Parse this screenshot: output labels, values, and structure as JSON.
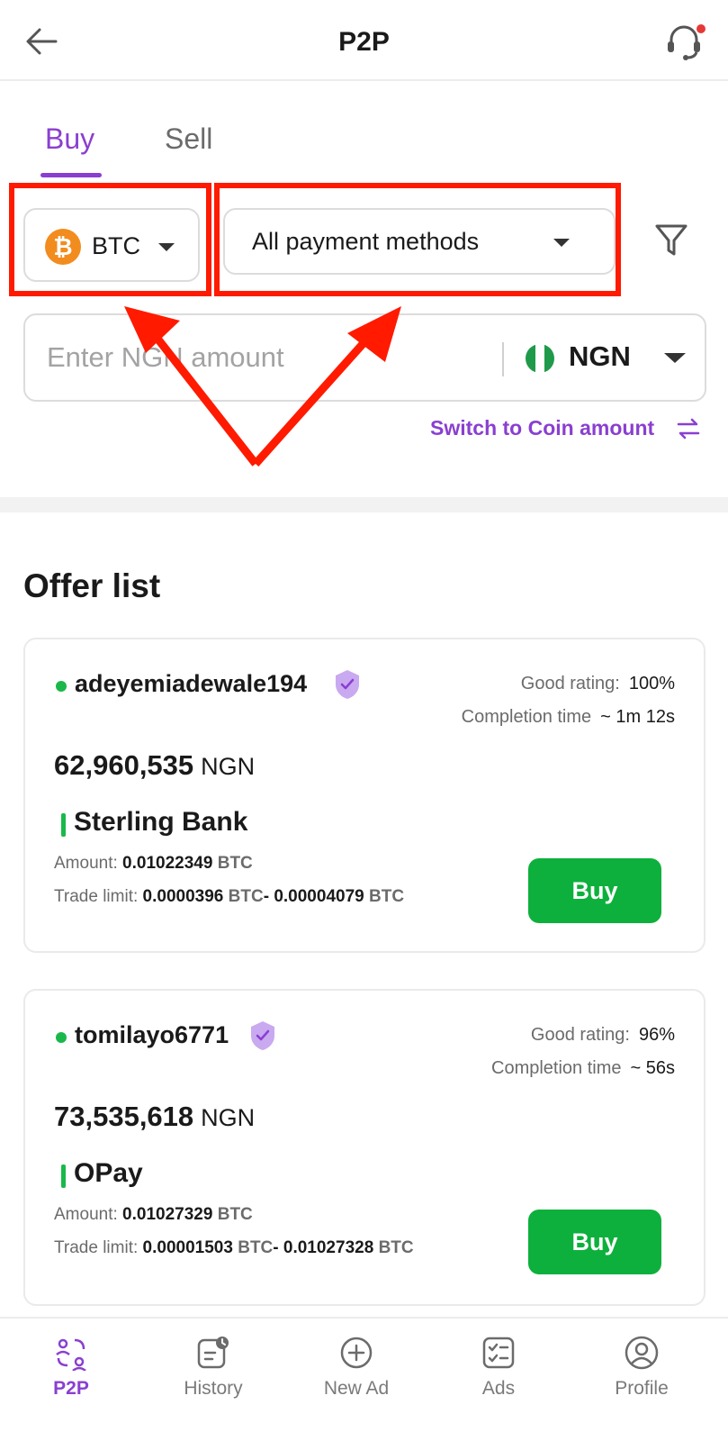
{
  "header": {
    "title": "P2P",
    "back_icon": "back-arrow-icon",
    "support_icon": "headset-support-icon"
  },
  "tabs": [
    {
      "label": "Buy",
      "active": true
    },
    {
      "label": "Sell",
      "active": false
    }
  ],
  "filters": {
    "coin": {
      "label": "BTC",
      "logo_glyph": "₿",
      "logo_color": "#f28c1e"
    },
    "payment_method": {
      "label": "All payment methods"
    },
    "filter_icon": "funnel-filter-icon"
  },
  "amount": {
    "placeholder": "Enter NGN amount",
    "value": "",
    "currency": "NGN"
  },
  "switch_link": "Switch to Coin amount",
  "offer_heading": "Offer list",
  "offers": [
    {
      "merchant": "adeyemiadewale194",
      "rating_label": "Good rating:",
      "rating_value": "100%",
      "completion_label": "Completion time",
      "completion_value": "~ 1m 12s",
      "price": "62,960,535",
      "price_currency": "NGN",
      "method": "Sterling Bank",
      "amount_label": "Amount:",
      "amount_value": "0.01022349",
      "amount_unit": "BTC",
      "limit_label": "Trade limit:",
      "limit_min": "0.0000396",
      "limit_min_unit": "BTC",
      "limit_sep": "- ",
      "limit_max": "0.00004079",
      "limit_max_unit": "BTC",
      "button": "Buy"
    },
    {
      "merchant": "tomilayo6771",
      "rating_label": "Good rating:",
      "rating_value": "96%",
      "completion_label": "Completion time",
      "completion_value": "~ 56s",
      "price": "73,535,618",
      "price_currency": "NGN",
      "method": "OPay",
      "amount_label": "Amount:",
      "amount_value": "0.01027329",
      "amount_unit": "BTC",
      "limit_label": "Trade limit:",
      "limit_min": "0.00001503",
      "limit_min_unit": "BTC",
      "limit_sep": "- ",
      "limit_max": "0.01027328",
      "limit_max_unit": "BTC",
      "button": "Buy"
    }
  ],
  "bottom_nav": [
    {
      "label": "P2P",
      "icon": "p2p-exchange-icon",
      "active": true
    },
    {
      "label": "History",
      "icon": "history-clock-icon",
      "active": false
    },
    {
      "label": "New Ad",
      "icon": "plus-circle-icon",
      "active": false
    },
    {
      "label": "Ads",
      "icon": "ads-checklist-icon",
      "active": false
    },
    {
      "label": "Profile",
      "icon": "profile-user-icon",
      "active": false
    }
  ],
  "colors": {
    "accent": "#8a3fd0",
    "buy_button": "#0db03c",
    "online": "#1ab84a",
    "annotation_red": "#ff1a00"
  }
}
